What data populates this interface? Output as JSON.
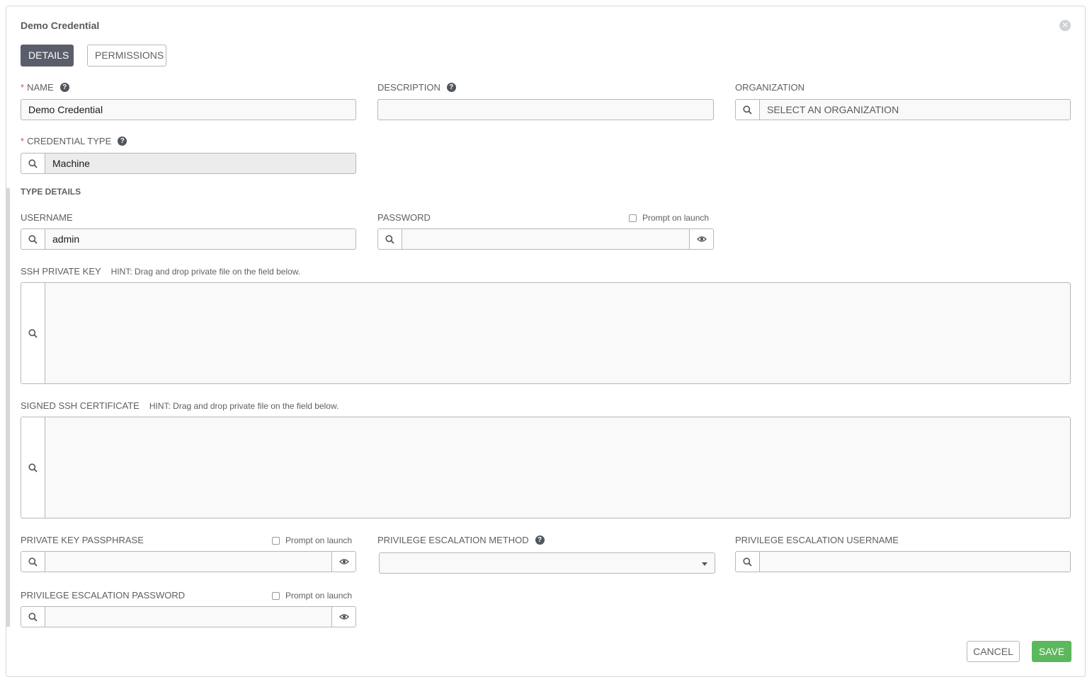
{
  "header": {
    "title": "Demo Credential"
  },
  "tabs": [
    {
      "label": "DETAILS",
      "active": true
    },
    {
      "label": "PERMISSIONS",
      "active": false
    }
  ],
  "fields": {
    "name": {
      "label": "NAME",
      "value": "Demo Credential",
      "required": true
    },
    "description": {
      "label": "DESCRIPTION",
      "value": ""
    },
    "organization": {
      "label": "ORGANIZATION",
      "placeholder": "SELECT AN ORGANIZATION"
    },
    "credential_type": {
      "label": "CREDENTIAL TYPE",
      "value": "Machine",
      "required": true
    }
  },
  "type_details": {
    "title": "TYPE DETAILS",
    "username": {
      "label": "USERNAME",
      "value": "admin"
    },
    "password": {
      "label": "PASSWORD",
      "prompt_label": "Prompt on launch"
    },
    "ssh_key": {
      "label": "SSH PRIVATE KEY",
      "hint": "HINT: Drag and drop private file on the field below."
    },
    "ssh_cert": {
      "label": "SIGNED SSH CERTIFICATE",
      "hint": "HINT: Drag and drop private file on the field below."
    },
    "key_passphrase": {
      "label": "PRIVATE KEY PASSPHRASE",
      "prompt_label": "Prompt on launch"
    },
    "escalation_method": {
      "label": "PRIVILEGE ESCALATION METHOD",
      "value": ""
    },
    "escalation_username": {
      "label": "PRIVILEGE ESCALATION USERNAME",
      "value": ""
    },
    "escalation_password": {
      "label": "PRIVILEGE ESCALATION PASSWORD",
      "prompt_label": "Prompt on launch"
    }
  },
  "footer": {
    "cancel_label": "CANCEL",
    "save_label": "SAVE"
  },
  "icons": {
    "close": "close-icon",
    "help": "question-circle-icon",
    "search": "search-icon",
    "eye": "eye-icon",
    "caret": "caret-down-icon"
  },
  "colors": {
    "active_tab": "#5a5e6a",
    "save": "#5cb85c",
    "required": "#d9534f",
    "border": "#b7b7b7"
  }
}
